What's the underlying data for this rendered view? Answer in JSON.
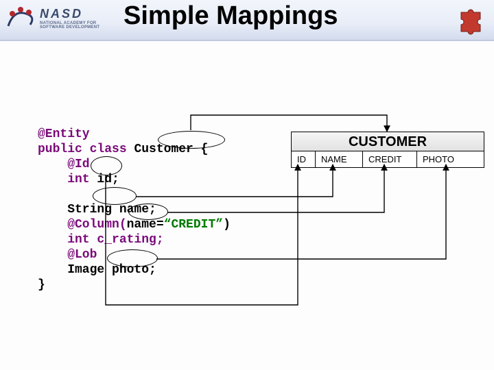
{
  "header": {
    "logo_brand": "NASD",
    "logo_sub1": "NATIONAL ACADEMY FOR",
    "logo_sub2": "SOFTWARE DEVELOPMENT"
  },
  "title": "Simple Mappings",
  "code": {
    "l1a": "@Entity",
    "l2a": "public class ",
    "l2b": "Customer",
    "l2c": " {",
    "l3a": "    @Id",
    "l4a": "    int ",
    "l4b": "id",
    "l4c": ";",
    "l5": "",
    "l6a": "    String ",
    "l6b": "name",
    "l6c": ";",
    "l7a": "    @Column(",
    "l7b": "name=",
    "l7c": "“CREDIT”",
    "l7d": ")",
    "l8a": "    int c_rating;",
    "l9a": "    @Lob",
    "l10a": "    Image ",
    "l10b": "photo",
    "l10c": ";",
    "l11a": "}"
  },
  "table": {
    "title": "CUSTOMER",
    "cols": [
      "ID",
      "NAME",
      "CREDIT",
      "PHOTO"
    ]
  }
}
